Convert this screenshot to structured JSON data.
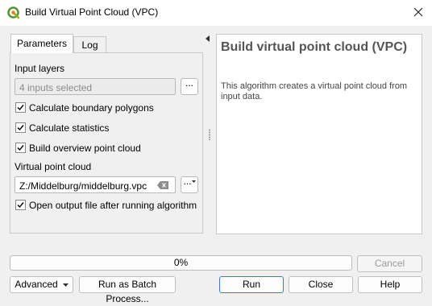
{
  "window": {
    "title": "Build Virtual Point Cloud (VPC)",
    "icon": "qgis-logo-icon",
    "close_icon": "close-icon"
  },
  "tabs": [
    {
      "label": "Parameters",
      "active": true
    },
    {
      "label": "Log",
      "active": false
    }
  ],
  "params": {
    "input_layers_label": "Input layers",
    "input_layers_value": "4 inputs selected",
    "browse_label": "...",
    "options": [
      {
        "label": "Calculate boundary polygons",
        "checked": true
      },
      {
        "label": "Calculate statistics",
        "checked": true
      },
      {
        "label": "Build overview point cloud",
        "checked": true
      }
    ],
    "output_label": "Virtual point cloud",
    "output_value": "Z:/Middelburg/middelburg.vpc",
    "output_browse_label": "...",
    "open_output": {
      "label": "Open output file after running algorithm",
      "checked": true
    }
  },
  "help": {
    "title": "Build virtual point cloud (VPC)",
    "body": "This algorithm creates a virtual point cloud from input data."
  },
  "footer": {
    "progress_text": "0%",
    "progress_value": 0,
    "cancel_label": "Cancel",
    "advanced_label": "Advanced",
    "batch_label": "Run as Batch Process...",
    "run_label": "Run",
    "close_label": "Close",
    "help_label": "Help"
  }
}
